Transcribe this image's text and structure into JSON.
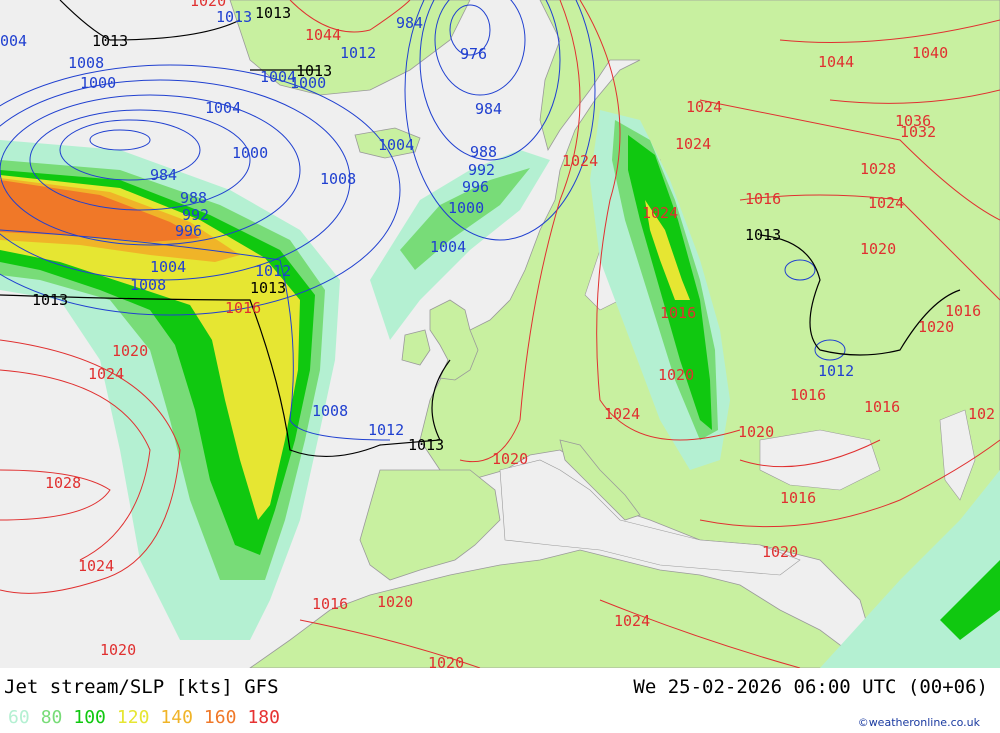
{
  "header": {
    "title": "Jet stream/SLP [kts] GFS",
    "datetime": "We 25-02-2026 06:00 UTC (00+06)"
  },
  "legend": {
    "items": [
      {
        "label": "60",
        "color": "#b4f0d2"
      },
      {
        "label": "80",
        "color": "#78dc78"
      },
      {
        "label": "100",
        "color": "#10c810"
      },
      {
        "label": "120",
        "color": "#e6e632"
      },
      {
        "label": "140",
        "color": "#f0b428"
      },
      {
        "label": "160",
        "color": "#f07828"
      },
      {
        "label": "180",
        "color": "#e63232"
      }
    ]
  },
  "credit": "©weatheronline.co.uk",
  "map": {
    "colors": {
      "sea": "#efefef",
      "land": "#c8f0a0",
      "low_isobar": "#2040d0",
      "high_isobar": "#e03030",
      "mean_isobar": "#000000"
    },
    "isobar_labels": {
      "blue": [
        "004",
        "1008",
        "1000",
        "1004",
        "1000",
        "984",
        "988",
        "992",
        "996",
        "1004",
        "1008",
        "1012",
        "1008",
        "1012",
        "1004",
        "1000",
        "996",
        "992",
        "988",
        "984",
        "976",
        "1004",
        "1008",
        "1012",
        "984",
        "1000",
        "1012",
        "1004",
        "1013"
      ],
      "red": [
        "1016",
        "1020",
        "1024",
        "1028",
        "1024",
        "1020",
        "1016",
        "1020",
        "1024",
        "1020",
        "1024",
        "1028",
        "1024",
        "1020",
        "1016",
        "1016",
        "1020",
        "1024",
        "1024",
        "1032",
        "1036",
        "1040",
        "1044",
        "1020",
        "1016",
        "1016",
        "1020",
        "1024",
        "1020",
        "1016",
        "1016",
        "102",
        "1044",
        "1020",
        "1024",
        "1020"
      ],
      "black": [
        "1013",
        "1013",
        "1013",
        "1013",
        "1013",
        "1013"
      ]
    }
  }
}
